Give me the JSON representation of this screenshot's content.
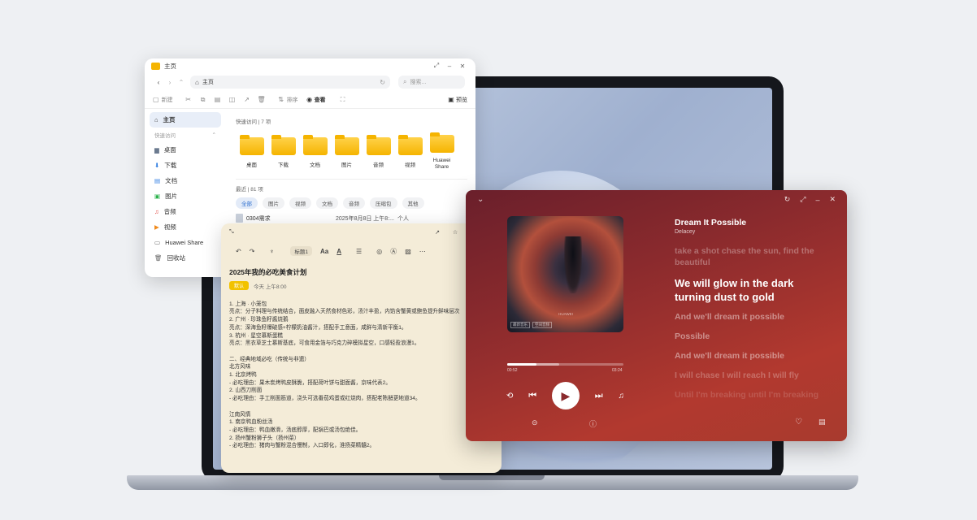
{
  "explorer": {
    "title": "主页",
    "address": "主页",
    "search_placeholder": "搜索...",
    "toolbar": {
      "new": "新建",
      "sort": "排序",
      "view": "查看",
      "preview": "预览"
    },
    "sidebar": {
      "home": "主页",
      "quick_access_label": "快速访问",
      "items": [
        "桌面",
        "下载",
        "文档",
        "图片",
        "音频",
        "视频",
        "Huawei Share",
        "回收站"
      ]
    },
    "quick_access": {
      "header": "快速访问 | 7 项",
      "folders": [
        "桌面",
        "下载",
        "文档",
        "图片",
        "音频",
        "视频",
        "Huawei Share"
      ]
    },
    "recent": {
      "header": "最近 | 81 项",
      "filters": [
        "全部",
        "图片",
        "视频",
        "文档",
        "音频",
        "压缩包",
        "其他"
      ],
      "file": {
        "name": "0304需求",
        "date": "2025年8月8日 上午8:...",
        "owner": "个人"
      }
    }
  },
  "notes": {
    "heading_style": "标题1",
    "title": "2025年我的必吃美食计划",
    "tag": "默认",
    "time": "今天 上午8:00",
    "lines": [
      "",
      "1. 上海 · 小笼包",
      "亮点：分子料理与传统结合，面皮融入天然食材色彩，汤汁丰盈，内馅含蟹黄或鲍鱼提升鲜味层次",
      "2. 广州 · 珍珠鱼籽酱烧鹅",
      "亮点：深海鱼籽爆破感+柠檬奶油酱汁，搭配手工意面，咸鲜与清新平衡1。",
      "3. 杭州 · 星空慕斯蛋糕",
      "亮点：黑衣草芝士慕斯基底，可食用金箔与巧克力碎模拟星空，口感轻盈浪漫1。",
      "",
      "二、经典地域必吃（传统与非遗）",
      "北方风味",
      "1. 北京烤鸭",
      "- 必吃理由：果木炭烤鸭皮酥脆，搭配荷叶饼与甜面酱，京味代表2。",
      "2. 山西刀削面",
      "- 必吃理由：手工削面筋道，浇头可选番茄鸡蛋或红烧肉，搭配老陈醋更地道34。",
      "",
      "江南风情",
      "1. 南京鸭血粉丝汤",
      "- 必吃理由：鸭血嫩滑，汤底醇厚，配锅巴或汤包绝佳。",
      "2. 扬州蟹粉狮子头（扬州菜）",
      "- 必吃理由：猪肉与蟹粉混合慢制，入口即化，淮扬菜精髓2。"
    ]
  },
  "music": {
    "song_title": "Dream It Possible",
    "artist": "Delacey",
    "lyrics": [
      "take a shot chase the sun, find the",
      "beautiful",
      "We will glow in the dark",
      "turning dust to gold",
      "And we'll dream it possible",
      "Possible",
      "And we'll dream it possible",
      "I will chase I will reach I will fly",
      "Until I'm breaking until I'm breaking"
    ],
    "current_time": "00:52",
    "total_time": "03:24",
    "progress": 0.25,
    "buffered": 0.45,
    "album_badges": [
      "HUAWEI",
      "最新音乐",
      "空间音频"
    ]
  },
  "colors": {
    "accent_blue": "#e8eef8",
    "folder": "#f5b400",
    "music_bg": "#8a2a2d",
    "notes_bg": "#f4ecd8"
  }
}
